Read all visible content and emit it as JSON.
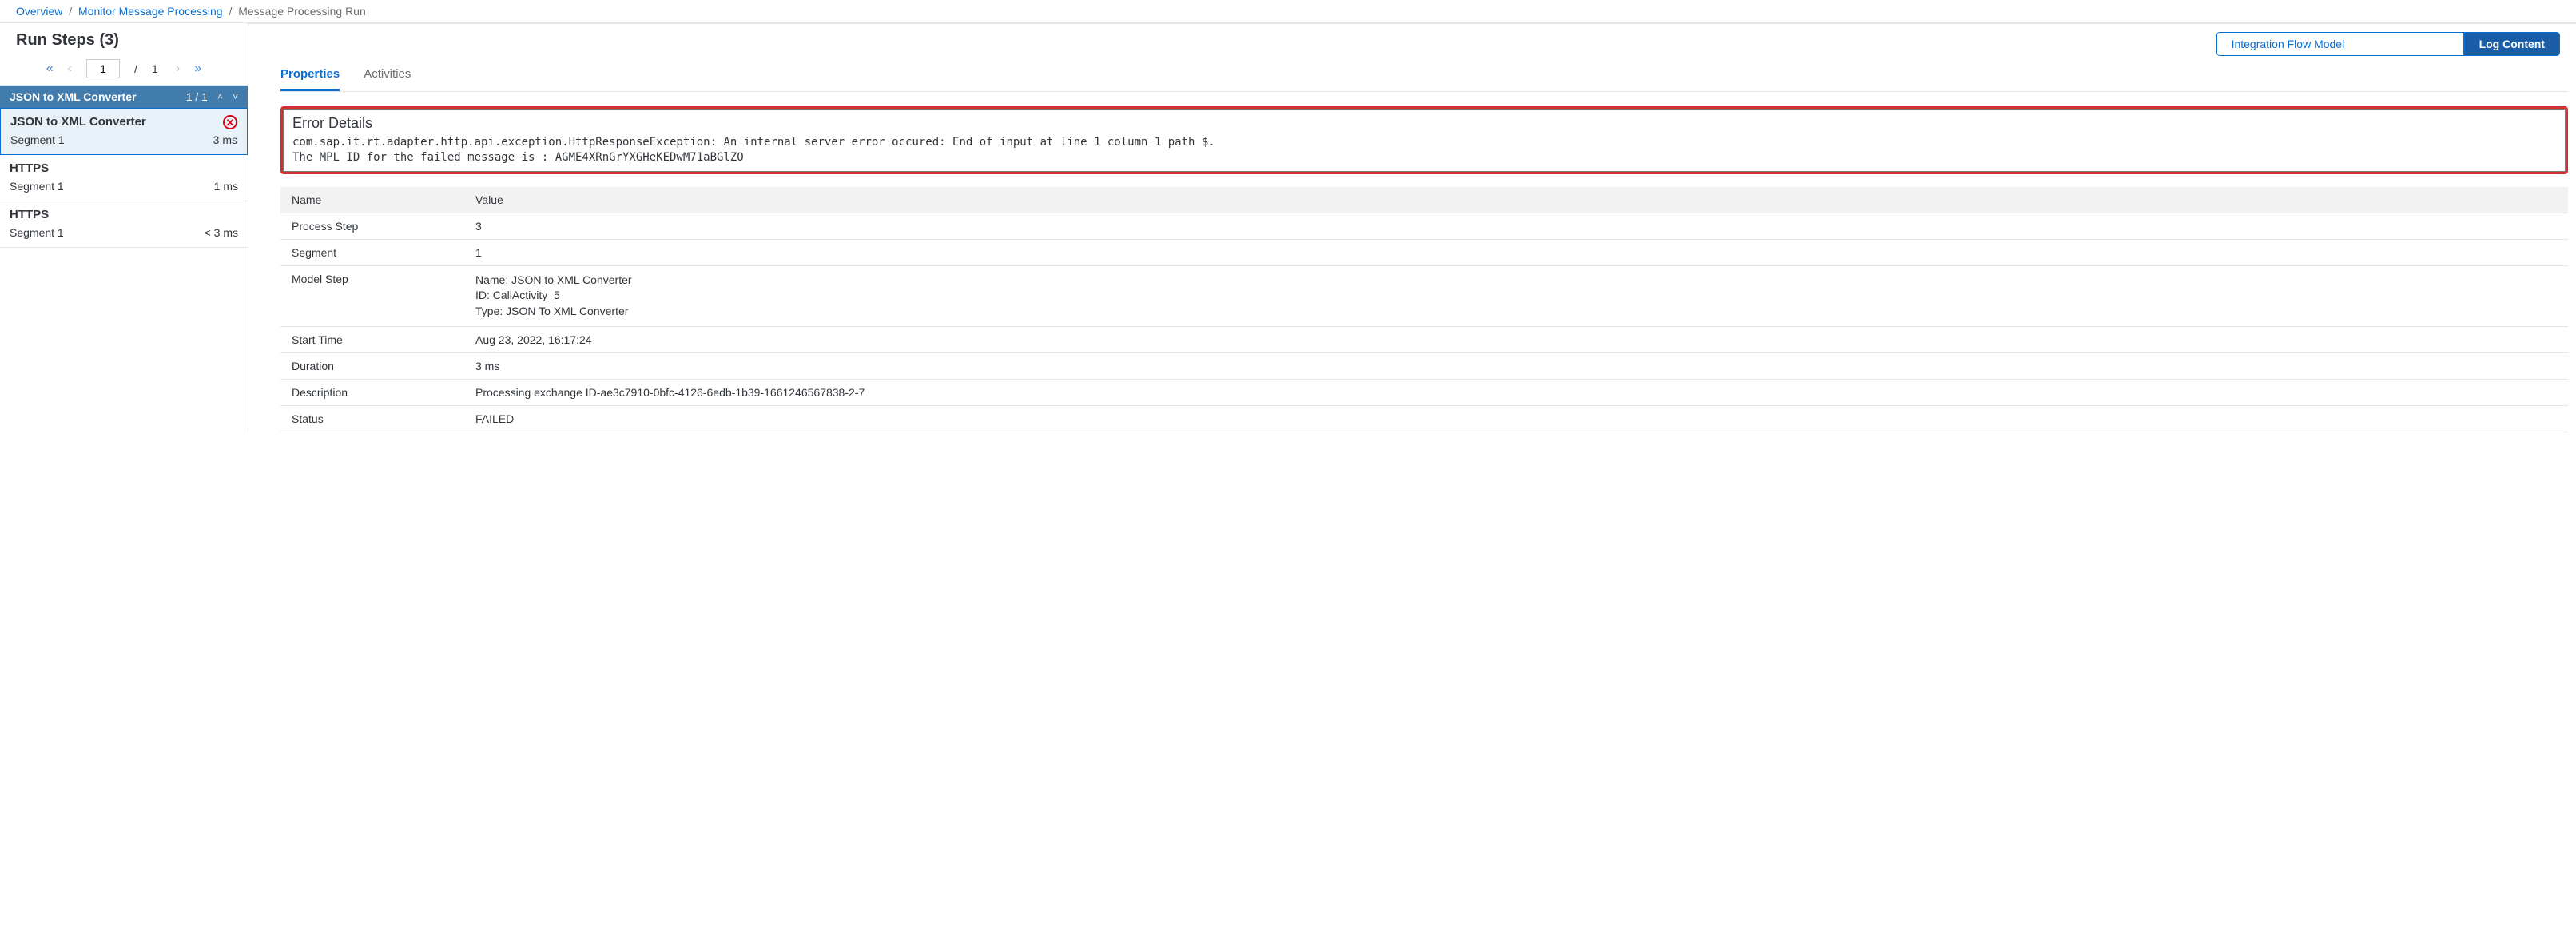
{
  "breadcrumb": {
    "items": [
      "Overview",
      "Monitor Message Processing"
    ],
    "current": "Message Processing Run"
  },
  "leftPanel": {
    "title": "Run Steps (3)",
    "pager": {
      "current": "1",
      "total": "1"
    },
    "groupHeader": {
      "name": "JSON to XML Converter",
      "count": "1 / 1"
    },
    "steps": [
      {
        "name": "JSON to XML Converter",
        "segment": "Segment 1",
        "duration": "3 ms",
        "error": true,
        "selected": true
      },
      {
        "name": "HTTPS",
        "segment": "Segment 1",
        "duration": "1 ms",
        "error": false,
        "selected": false
      },
      {
        "name": "HTTPS",
        "segment": "Segment 1",
        "duration": "< 3 ms",
        "error": false,
        "selected": false
      }
    ]
  },
  "toggle": {
    "model": "Integration Flow Model",
    "log": "Log Content"
  },
  "tabs": {
    "properties": "Properties",
    "activities": "Activities"
  },
  "errorBox": {
    "title": "Error Details",
    "text": "com.sap.it.rt.adapter.http.api.exception.HttpResponseException: An internal server error occured: End of input at line 1 column 1 path $.\nThe MPL ID for the failed message is : AGME4XRnGrYXGHeKEDwM71aBGlZO"
  },
  "propsTable": {
    "headers": {
      "name": "Name",
      "value": "Value"
    },
    "rows": [
      {
        "k": "Process Step",
        "v": "3"
      },
      {
        "k": "Segment",
        "v": "1"
      },
      {
        "k": "Model Step",
        "v": "Name: JSON to XML Converter\nID: CallActivity_5\nType: JSON To XML Converter",
        "multi": true
      },
      {
        "k": "Start Time",
        "v": "Aug 23, 2022, 16:17:24"
      },
      {
        "k": "Duration",
        "v": "3 ms"
      },
      {
        "k": "Description",
        "v": "Processing exchange ID-ae3c7910-0bfc-4126-6edb-1b39-1661246567838-2-7"
      },
      {
        "k": "Status",
        "v": "FAILED"
      }
    ]
  }
}
